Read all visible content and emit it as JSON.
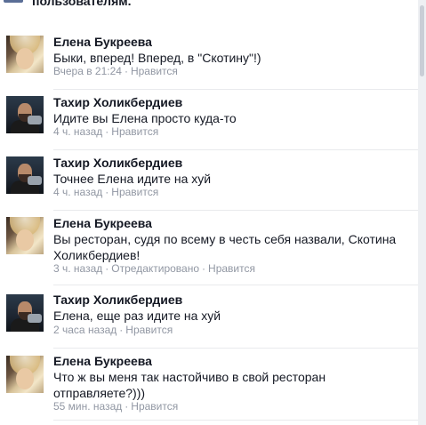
{
  "header": {
    "partial_text": "пользователям."
  },
  "actions": {
    "like": "Нравится",
    "edited": "Отредактировано",
    "sep": "·"
  },
  "comments": [
    {
      "author": "Елена Букреева",
      "text": "Быки, вперед! Вперед, в \"Скотину\"!)",
      "time": "Вчера в 21:24",
      "avatar": "elena-avatar"
    },
    {
      "author": "Тахир Холикбердиев",
      "text": "Идите вы Елена просто куда-то",
      "time": "4 ч. назад",
      "avatar": "tahir-avatar"
    },
    {
      "author": "Тахир Холикбердиев",
      "text": "Точнее Елена идите на хуй",
      "time": "4 ч. назад",
      "avatar": "tahir-avatar"
    },
    {
      "author": "Елена Букреева",
      "text": "Вы ресторан, судя по всему в честь себя назвали, Скотина Холикбердиев!",
      "time": "3 ч. назад",
      "edited": true,
      "avatar": "elena-avatar"
    },
    {
      "author": "Тахир Холикбердиев",
      "text": "Елена, еще раз идите на хуй",
      "time": "2 часа назад",
      "avatar": "tahir-avatar"
    },
    {
      "author": "Елена Букреева",
      "text": "Что ж вы меня так настойчиво в свой ресторан отправляете?)))",
      "time": "55 мин. назад",
      "avatar": "elena-avatar"
    }
  ]
}
